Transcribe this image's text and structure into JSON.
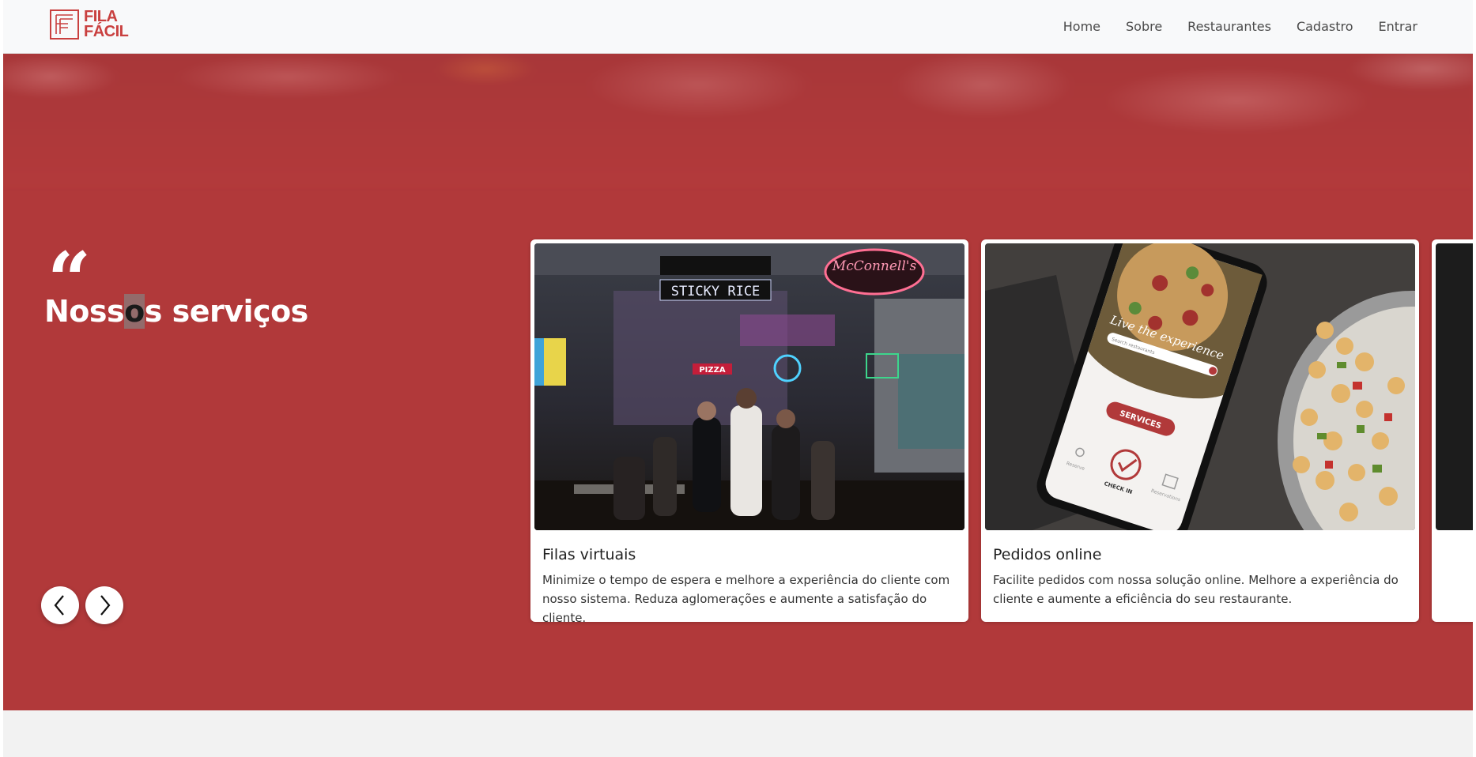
{
  "brand": {
    "line1": "FILA",
    "line2": "FÁCIL",
    "color": "#c9403f"
  },
  "nav": {
    "items": [
      "Home",
      "Sobre",
      "Restaurantes",
      "Cadastro",
      "Entrar"
    ]
  },
  "hero": {
    "quote_mark": "“",
    "title_before": "Noss",
    "title_caret": "o",
    "title_after": "s serviços",
    "background_color": "#b1393a"
  },
  "carousel": {
    "prev_icon": "chevron-left-icon",
    "next_icon": "chevron-right-icon",
    "cards": [
      {
        "title": "Filas virtuais",
        "text": "Minimize o tempo de espera e melhore a experiência do cliente com nosso sistema. Reduza aglomerações e aumente a satisfação do cliente.",
        "image_sign_1": "STICKY RICE",
        "image_sign_2": "McConnell's",
        "image_sign_3": "PIZZA"
      },
      {
        "title": "Pedidos online",
        "text": "Facilite pedidos com nossa solução online. Melhore a experiência do cliente e aumente a eficiência do seu restaurante.",
        "phone_tagline": "Live the experience",
        "phone_search": "Search restaurants",
        "phone_button": "SERVICES",
        "phone_checkin": "CHECK IN",
        "phone_tab_1": "Reserve",
        "phone_tab_2": "Reservations"
      }
    ]
  }
}
